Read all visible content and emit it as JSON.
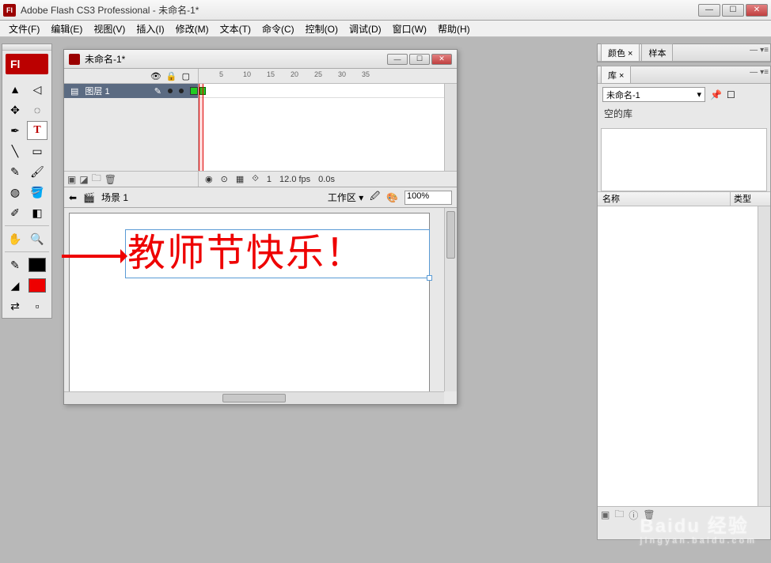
{
  "app": {
    "title": "Adobe Flash CS3 Professional - 未命名-1*",
    "logo": "Fl"
  },
  "menu": [
    "文件(F)",
    "编辑(E)",
    "视图(V)",
    "插入(I)",
    "修改(M)",
    "文本(T)",
    "命令(C)",
    "控制(O)",
    "调试(D)",
    "窗口(W)",
    "帮助(H)"
  ],
  "doc": {
    "title": "未命名-1*"
  },
  "timeline": {
    "ticks": [
      5,
      10,
      15,
      20,
      25,
      30,
      35
    ],
    "layer": "图层 1",
    "frame": "1",
    "fps": "12.0 fps",
    "time": "0.0s"
  },
  "editbar": {
    "scene": "场景 1",
    "workarea": "工作区 ▾",
    "zoom": "100%"
  },
  "stage": {
    "text": "教师节快乐！"
  },
  "panels": {
    "color_tabs": [
      "颜色 ×",
      "样本"
    ],
    "lib_tab": "库 ×",
    "lib_doc": "未命名-1",
    "lib_empty": "空的库",
    "lib_cols": {
      "name": "名称",
      "type": "类型"
    }
  },
  "watermark": {
    "brand": "Baidu 经验",
    "sub": "jingyan.baidu.com"
  }
}
